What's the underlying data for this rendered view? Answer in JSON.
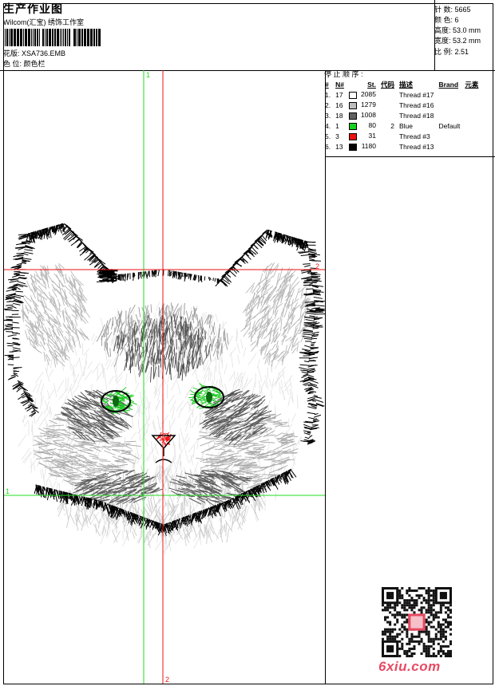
{
  "header": {
    "title": "生产作业图",
    "subtitle": "Wilcom(汇宝) 绣饰工作室",
    "pattern_label": "花版:",
    "pattern_value": "XSA736.EMB",
    "position_label": "色 位:",
    "position_value": "颜色栏"
  },
  "stats": [
    {
      "label": "针 数:",
      "value": "5665"
    },
    {
      "label": "颜 色:",
      "value": "6"
    },
    {
      "label": "高度:",
      "value": "53.0 mm"
    },
    {
      "label": "宽度:",
      "value": "53.2 mm"
    },
    {
      "label": "比 例:",
      "value": "2.51"
    }
  ],
  "stop_sequence": {
    "title": "停 止 顺 序 :",
    "columns": [
      "#",
      "N#",
      "St.",
      "代码",
      "描述",
      "Brand",
      "元素"
    ],
    "rows": [
      {
        "index": "1.",
        "n": "17",
        "color": "#ffffff",
        "st": "2085",
        "code": "",
        "desc": "Thread #17",
        "brand": "",
        "element": ""
      },
      {
        "index": "2.",
        "n": "16",
        "color": "#bdbdbd",
        "st": "1279",
        "code": "",
        "desc": "Thread #16",
        "brand": "",
        "element": ""
      },
      {
        "index": "3.",
        "n": "18",
        "color": "#606060",
        "st": "1008",
        "code": "",
        "desc": "Thread #18",
        "brand": "",
        "element": ""
      },
      {
        "index": "4.",
        "n": "1",
        "color": "#18d020",
        "st": "80",
        "code": "2",
        "desc": "Blue",
        "brand": "Default",
        "element": ""
      },
      {
        "index": "5.",
        "n": "3",
        "color": "#ee1010",
        "st": "31",
        "code": "",
        "desc": "Thread #3",
        "brand": "",
        "element": ""
      },
      {
        "index": "6.",
        "n": "13",
        "color": "#000000",
        "st": "1180",
        "code": "",
        "desc": "Thread #13",
        "brand": "",
        "element": ""
      }
    ]
  },
  "guides": {
    "green_top": "1",
    "green_left": "1",
    "red_right": "2",
    "red_bottom": "2"
  },
  "colors": {
    "guide_green": "#22dd22",
    "guide_red": "#ee1111",
    "logo": "#e74a63"
  },
  "watermark": "6xiu.com"
}
